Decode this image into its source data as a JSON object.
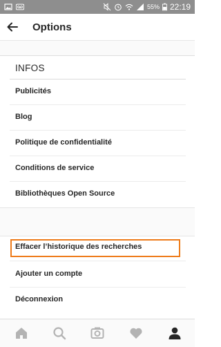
{
  "status_bar": {
    "battery": "55%",
    "time": "22:19",
    "icons": [
      "image-icon",
      "voicemail-icon",
      "mute-icon",
      "alarm-icon",
      "wifi-icon",
      "signal-icon",
      "battery-icon"
    ]
  },
  "appbar": {
    "title": "Options",
    "back_icon": "arrow-left-icon"
  },
  "section": {
    "header": "INFOS",
    "items": [
      "Publicités",
      "Blog",
      "Politique de confidentialité",
      "Conditions de service",
      "Bibliothèques Open Source"
    ]
  },
  "account_section": {
    "items": [
      "Effacer l’historique des recherches",
      "Ajouter un compte",
      "Déconnexion"
    ]
  },
  "bottom_nav": {
    "items": [
      "home-icon",
      "search-icon",
      "camera-icon",
      "heart-icon",
      "profile-icon"
    ],
    "active_index": 4
  },
  "colors": {
    "statusbar": "#8e8e8e",
    "text": "#262626",
    "highlight": "#ee7b19",
    "inactive_icon": "#b3b3b3"
  }
}
